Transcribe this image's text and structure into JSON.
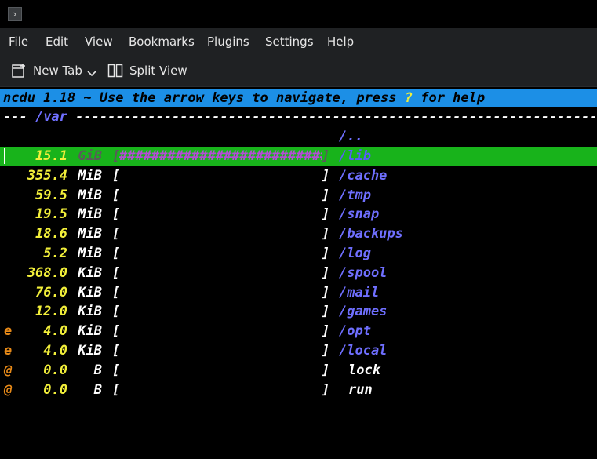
{
  "window": {
    "titlebar_icon": "terminal-icon"
  },
  "menubar": {
    "items": [
      "File",
      "Edit",
      "View",
      "Bookmarks",
      "Plugins",
      "Settings",
      "Help"
    ]
  },
  "toolbar": {
    "new_tab_label": "New Tab",
    "split_view_label": "Split View"
  },
  "terminal": {
    "header_pre": "ncdu 1.18 ~ Use the arrow keys to navigate, press ",
    "header_key": "?",
    "header_post": " for help",
    "path_prefix": "--- ",
    "path": "/var",
    "path_dashes": " ----------------------------------------------------------------------------",
    "parent_dir": "/..",
    "entries": [
      {
        "flag": "",
        "size": "15.1",
        "unit": "GiB",
        "bar": "##########################",
        "name": "/lib",
        "is_dir": true,
        "selected": true
      },
      {
        "flag": "",
        "size": "355.4",
        "unit": "MiB",
        "bar": "",
        "name": "/cache",
        "is_dir": true
      },
      {
        "flag": "",
        "size": "59.5",
        "unit": "MiB",
        "bar": "",
        "name": "/tmp",
        "is_dir": true
      },
      {
        "flag": "",
        "size": "19.5",
        "unit": "MiB",
        "bar": "",
        "name": "/snap",
        "is_dir": true
      },
      {
        "flag": "",
        "size": "18.6",
        "unit": "MiB",
        "bar": "",
        "name": "/backups",
        "is_dir": true
      },
      {
        "flag": "",
        "size": "5.2",
        "unit": "MiB",
        "bar": "",
        "name": "/log",
        "is_dir": true
      },
      {
        "flag": "",
        "size": "368.0",
        "unit": "KiB",
        "bar": "",
        "name": "/spool",
        "is_dir": true
      },
      {
        "flag": "",
        "size": "76.0",
        "unit": "KiB",
        "bar": "",
        "name": "/mail",
        "is_dir": true
      },
      {
        "flag": "",
        "size": "12.0",
        "unit": "KiB",
        "bar": "",
        "name": "/games",
        "is_dir": true
      },
      {
        "flag": "e",
        "size": "4.0",
        "unit": "KiB",
        "bar": "",
        "name": "/opt",
        "is_dir": true
      },
      {
        "flag": "e",
        "size": "4.0",
        "unit": "KiB",
        "bar": "",
        "name": "/local",
        "is_dir": true
      },
      {
        "flag": "@",
        "size": "0.0",
        "unit": "B",
        "bar": "",
        "name": "lock",
        "is_dir": false
      },
      {
        "flag": "@",
        "size": "0.0",
        "unit": "B",
        "bar": "",
        "name": "run",
        "is_dir": false
      }
    ]
  },
  "colors": {
    "header_bg": "#1c8fe6",
    "selected_bg": "#18b31b",
    "size_yellow": "#f2ef3a",
    "dir_blue": "#6f6fff",
    "flag_orange": "#e88a18",
    "bar_purple": "#b54cd6"
  }
}
